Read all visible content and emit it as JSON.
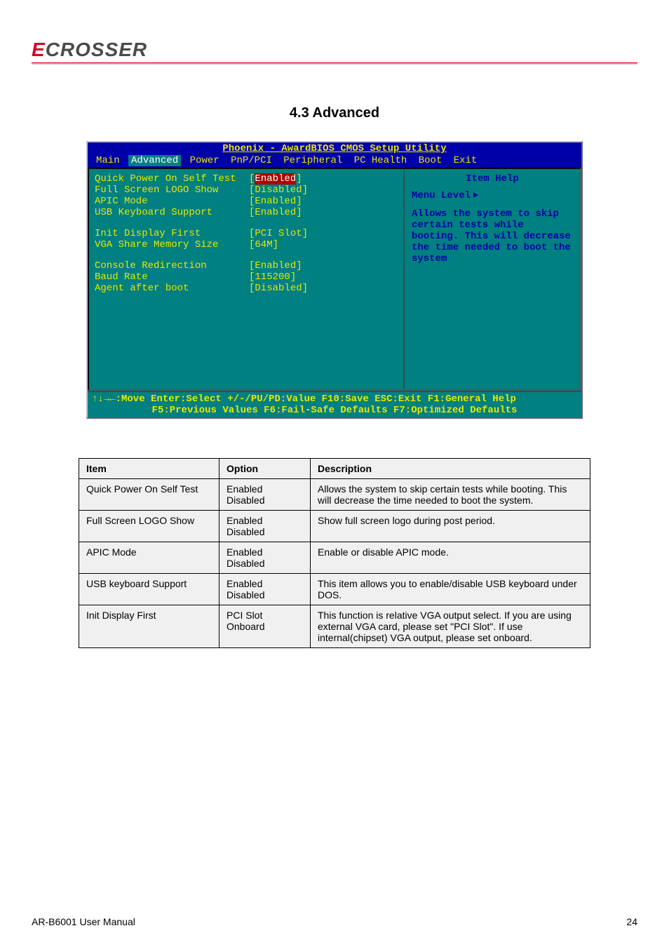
{
  "logo": {
    "prefix": "E",
    "rest": "CROSSER"
  },
  "section_title": "4.3 Advanced",
  "bios": {
    "title": "Phoenix - AwardBIOS CMOS Setup Utility",
    "menu": [
      "Main",
      "Advanced",
      "Power",
      "PnP/PCI",
      "Peripheral",
      "PC Health",
      "Boot",
      "Exit"
    ],
    "menu_selected": 1,
    "options": [
      {
        "label": "Quick Power On Self Test",
        "value": "Enabled",
        "hilite": true
      },
      {
        "label": "Full Screen LOGO Show",
        "value": "Disabled"
      },
      {
        "label": "APIC Mode",
        "value": "Enabled"
      },
      {
        "label": "USB Keyboard Support",
        "value": "Enabled"
      },
      {
        "spacer": true
      },
      {
        "label": "Init Display First",
        "value": "PCI Slot"
      },
      {
        "label": "VGA Share Memory Size",
        "value": "64M"
      },
      {
        "spacer": true
      },
      {
        "label": "Console Redirection",
        "value": "Enabled"
      },
      {
        "label": "Baud Rate",
        "value": "115200"
      },
      {
        "label": "Agent after boot",
        "value": "Disabled"
      }
    ],
    "help_title": "Item Help",
    "menu_level_label": "Menu Level",
    "help_text": "Allows the system to skip certain tests while booting. This will decrease the time needed to boot the system",
    "foot1": "↑↓→←:Move  Enter:Select   +/-/PU/PD:Value  F10:Save   ESC:Exit  F1:General Help",
    "foot2": "F5:Previous Values    F6:Fail-Safe Defaults    F7:Optimized Defaults"
  },
  "table": {
    "headers": [
      "Item",
      "Option",
      "Description"
    ],
    "rows": [
      {
        "item": "Quick Power On Self Test",
        "option": "Enabled Disabled",
        "desc": "Allows the system to skip certain tests while booting. This will decrease the time needed to boot the system."
      },
      {
        "item": "Full Screen LOGO Show",
        "option": "Enabled Disabled",
        "desc": "Show full screen logo during post period."
      },
      {
        "item": "APIC Mode",
        "option": "Enabled Disabled",
        "desc": "Enable or disable APIC mode."
      },
      {
        "item": "USB keyboard Support",
        "option": "Enabled Disabled",
        "desc": "This item allows you to enable/disable USB keyboard under DOS."
      },
      {
        "item": "Init Display First",
        "option": "PCI Slot Onboard",
        "desc": "This function is relative VGA output select. If you are using external VGA card, please set \"PCI Slot\". If use internal(chipset) VGA output, please set onboard."
      }
    ]
  },
  "footer": {
    "left": "AR-B6001 User Manual",
    "right": "24"
  }
}
